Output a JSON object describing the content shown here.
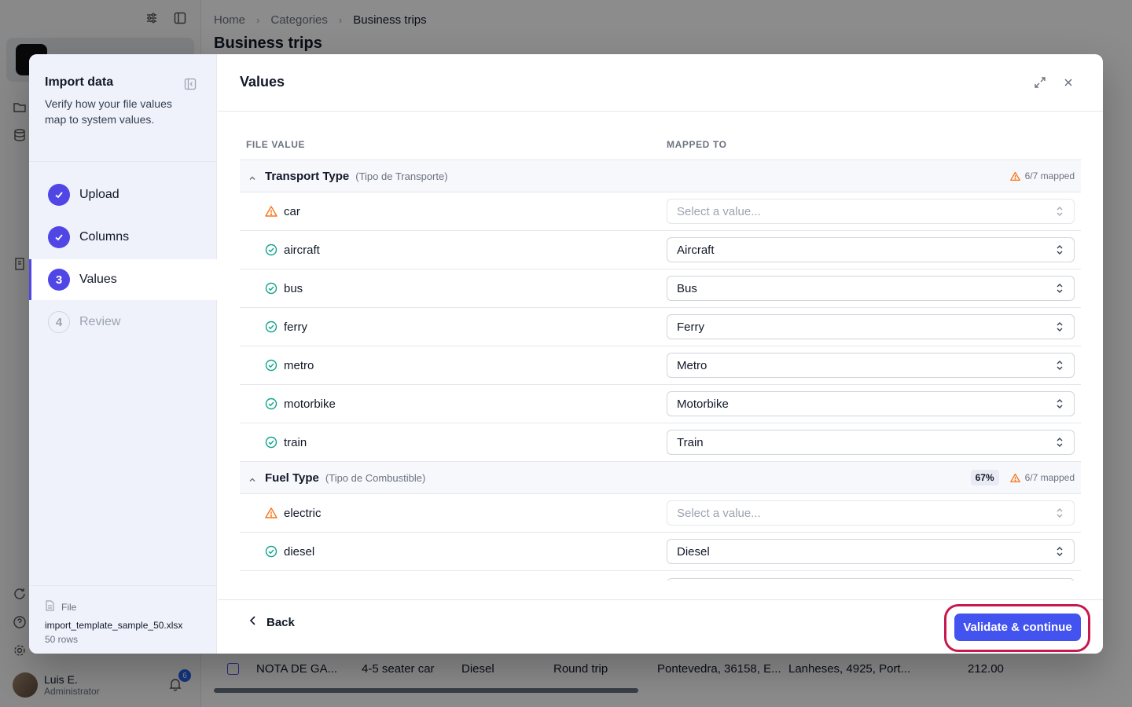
{
  "background": {
    "breadcrumb": [
      "Home",
      "Categories",
      "Business trips"
    ],
    "page_title": "Business trips",
    "user": {
      "name": "Luis E.",
      "role": "Administrator",
      "notifications": "6"
    },
    "table_row": {
      "name": "NOTA DE GA...",
      "vehicle": "4-5 seater car",
      "fuel": "Diesel",
      "trip": "Round trip",
      "origin": "Pontevedra, 36158, E...",
      "destination": "Lanheses, 4925, Port...",
      "amount": "212.00"
    }
  },
  "modal": {
    "sidebar": {
      "title": "Import data",
      "description": "Verify how your file values map to system values.",
      "steps": [
        {
          "number": "1",
          "label": "Upload",
          "state": "done"
        },
        {
          "number": "2",
          "label": "Columns",
          "state": "done"
        },
        {
          "number": "3",
          "label": "Values",
          "state": "current"
        },
        {
          "number": "4",
          "label": "Review",
          "state": "todo"
        }
      ],
      "file": {
        "label": "File",
        "name": "import_template_sample_50.xlsx",
        "rows": "50 rows"
      }
    },
    "title": "Values",
    "columns": {
      "file_value": "FILE VALUE",
      "mapped_to": "MAPPED TO"
    },
    "groups": [
      {
        "name": "Transport Type",
        "subtitle": "(Tipo de Transporte)",
        "percent": "",
        "status": "6/7 mapped",
        "rows": [
          {
            "value": "car",
            "mapped": "",
            "placeholder": "Select a value...",
            "ok": false
          },
          {
            "value": "aircraft",
            "mapped": "Aircraft",
            "ok": true
          },
          {
            "value": "bus",
            "mapped": "Bus",
            "ok": true
          },
          {
            "value": "ferry",
            "mapped": "Ferry",
            "ok": true
          },
          {
            "value": "metro",
            "mapped": "Metro",
            "ok": true
          },
          {
            "value": "motorbike",
            "mapped": "Motorbike",
            "ok": true
          },
          {
            "value": "train",
            "mapped": "Train",
            "ok": true
          }
        ]
      },
      {
        "name": "Fuel Type",
        "subtitle": "(Tipo de Combustible)",
        "percent": "67%",
        "status": "6/7 mapped",
        "rows": [
          {
            "value": "electric",
            "mapped": "",
            "placeholder": "Select a value...",
            "ok": false
          },
          {
            "value": "diesel",
            "mapped": "Diesel",
            "ok": true
          }
        ]
      }
    ],
    "footer": {
      "back": "Back",
      "validate": "Validate & continue"
    },
    "colors": {
      "accent": "#4353f0",
      "ok": "#14a38b",
      "warn": "#f97316",
      "highlight": "#c8194f"
    }
  }
}
